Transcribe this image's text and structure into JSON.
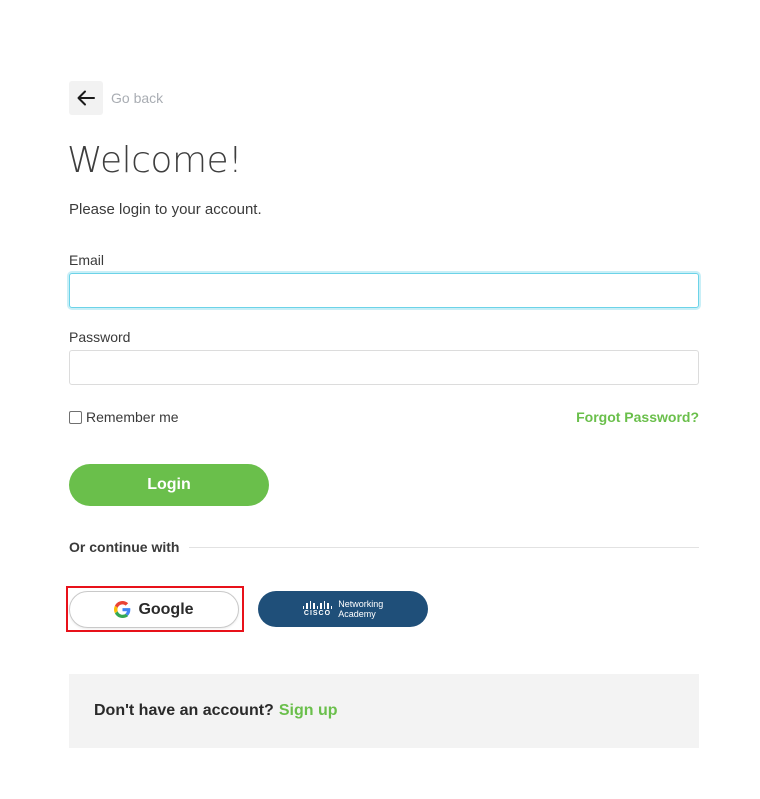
{
  "back": {
    "label": "Go back",
    "icon": "arrow-left-icon"
  },
  "heading": {
    "title": "Welcome!",
    "subtitle": "Please login to your account."
  },
  "form": {
    "email": {
      "label": "Email",
      "value": "",
      "placeholder": ""
    },
    "password": {
      "label": "Password",
      "value": "",
      "placeholder": ""
    },
    "remember_label": "Remember me",
    "remember_checked": false,
    "forgot_label": "Forgot Password?",
    "login_label": "Login"
  },
  "alt_login": {
    "divider_label": "Or continue with",
    "google_label": "Google",
    "cisco": {
      "brand": "CISCO",
      "line1": "Networking",
      "line2": "Academy"
    }
  },
  "signup": {
    "question": "Don't have an account?",
    "link": "Sign up"
  },
  "colors": {
    "accent_green": "#6abf4b",
    "cisco_blue": "#1f4f79",
    "focus_ring": "#6cd3e8",
    "highlight_red": "#e8111a"
  }
}
